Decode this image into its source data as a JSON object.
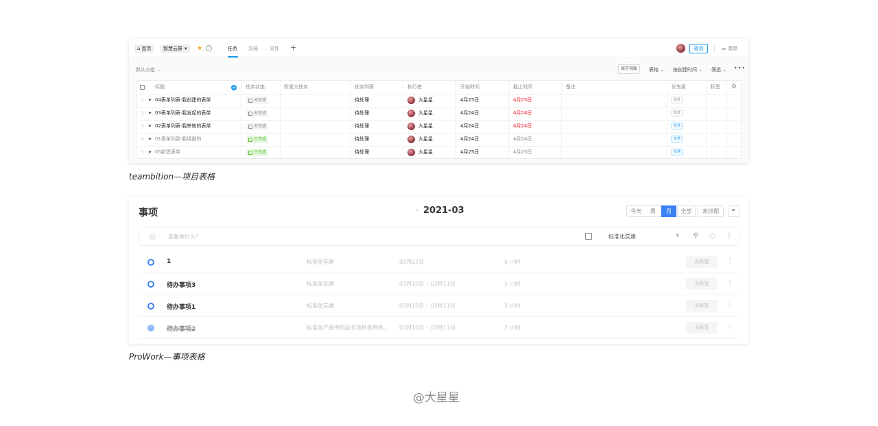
{
  "teambition": {
    "topbar": {
      "home": "首页",
      "project": "智慧云屏",
      "tabs": [
        "任务",
        "文档",
        "文件"
      ],
      "invite": "邀请",
      "menu": "菜单"
    },
    "toolbar": {
      "group_by": "默认分组",
      "save_view": "保存视图",
      "view_table": "表格",
      "sort": "按创建时间",
      "filter": "筛选"
    },
    "columns": [
      "标题",
      "任务状态",
      "所属父任务",
      "任务列表",
      "执行者",
      "开始时间",
      "截止时间",
      "备注",
      "优先级",
      "标签"
    ],
    "rows": [
      {
        "num": "1",
        "title": "04表单列表-我创建的表单",
        "status": "未完成",
        "status_type": "todo",
        "list": "待处理",
        "assignee": "大星星",
        "start": "4月25日",
        "due": "4月25日",
        "due_red": true,
        "priority": "较低",
        "priority_type": "low",
        "dim": false
      },
      {
        "num": "2",
        "title": "03表单列表-我发起的表单",
        "status": "未完成",
        "status_type": "todo",
        "list": "待处理",
        "assignee": "大星星",
        "start": "4月24日",
        "due": "4月24日",
        "due_red": true,
        "priority": "较低",
        "priority_type": "low",
        "dim": false
      },
      {
        "num": "3",
        "title": "02表单列表-我审核的表单",
        "status": "未完成",
        "status_type": "todo",
        "list": "待处理",
        "assignee": "大星星",
        "start": "4月24日",
        "due": "4月24日",
        "due_red": true,
        "priority": "普通",
        "priority_type": "normal",
        "dim": false
      },
      {
        "num": "4",
        "title": "01表单列到-我填报的",
        "status": "已完成",
        "status_type": "done",
        "list": "待处理",
        "assignee": "大星星",
        "start": "4月24日",
        "due": "4月24日",
        "due_red": false,
        "priority": "普通",
        "priority_type": "normal",
        "dim": true
      },
      {
        "num": "5",
        "title": "05新建表单",
        "status": "已完成",
        "status_type": "done",
        "list": "待处理",
        "assignee": "大星星",
        "start": "4月25日",
        "due": "4月25日",
        "due_red": false,
        "priority": "普通",
        "priority_type": "normal",
        "dim": true
      }
    ]
  },
  "caption1": "teambition—项目表格",
  "prowork": {
    "title": "事项",
    "date": "2021-03",
    "segments": [
      "今天",
      "周",
      "月",
      "全部",
      "未排期"
    ],
    "active_segment": "月",
    "input_placeholder": "准备做什么?",
    "project_select": "标准化党建",
    "tasks": [
      {
        "title": "1",
        "project": "标准化党建",
        "date": "03月23日",
        "hours": "5 小时",
        "tag": "无标签",
        "done": false
      },
      {
        "title": "待办事项3",
        "project": "标准化党建",
        "date": "03月10日 – 03月11日",
        "hours": "5 小时",
        "tag": "无标签",
        "done": false
      },
      {
        "title": "待办事项1",
        "project": "标准化党建",
        "date": "03月10日 – 03月11日",
        "hours": "5 小时",
        "tag": "无标签",
        "done": false
      },
      {
        "title": "待办事项2",
        "project": "标准化产品中的超长项目名称名...",
        "date": "03月10日 – 03月11日",
        "hours": "2 小时",
        "tag": "无标签",
        "done": true
      }
    ]
  },
  "caption2": "ProWork—事项表格",
  "watermark": "@大星星",
  "colors": {
    "accent_blue": "#1b9aee",
    "overdue_red": "#f5222d",
    "done_green": "#52c41a",
    "prowork_blue": "#3b82f6",
    "star": "#f5a623"
  }
}
